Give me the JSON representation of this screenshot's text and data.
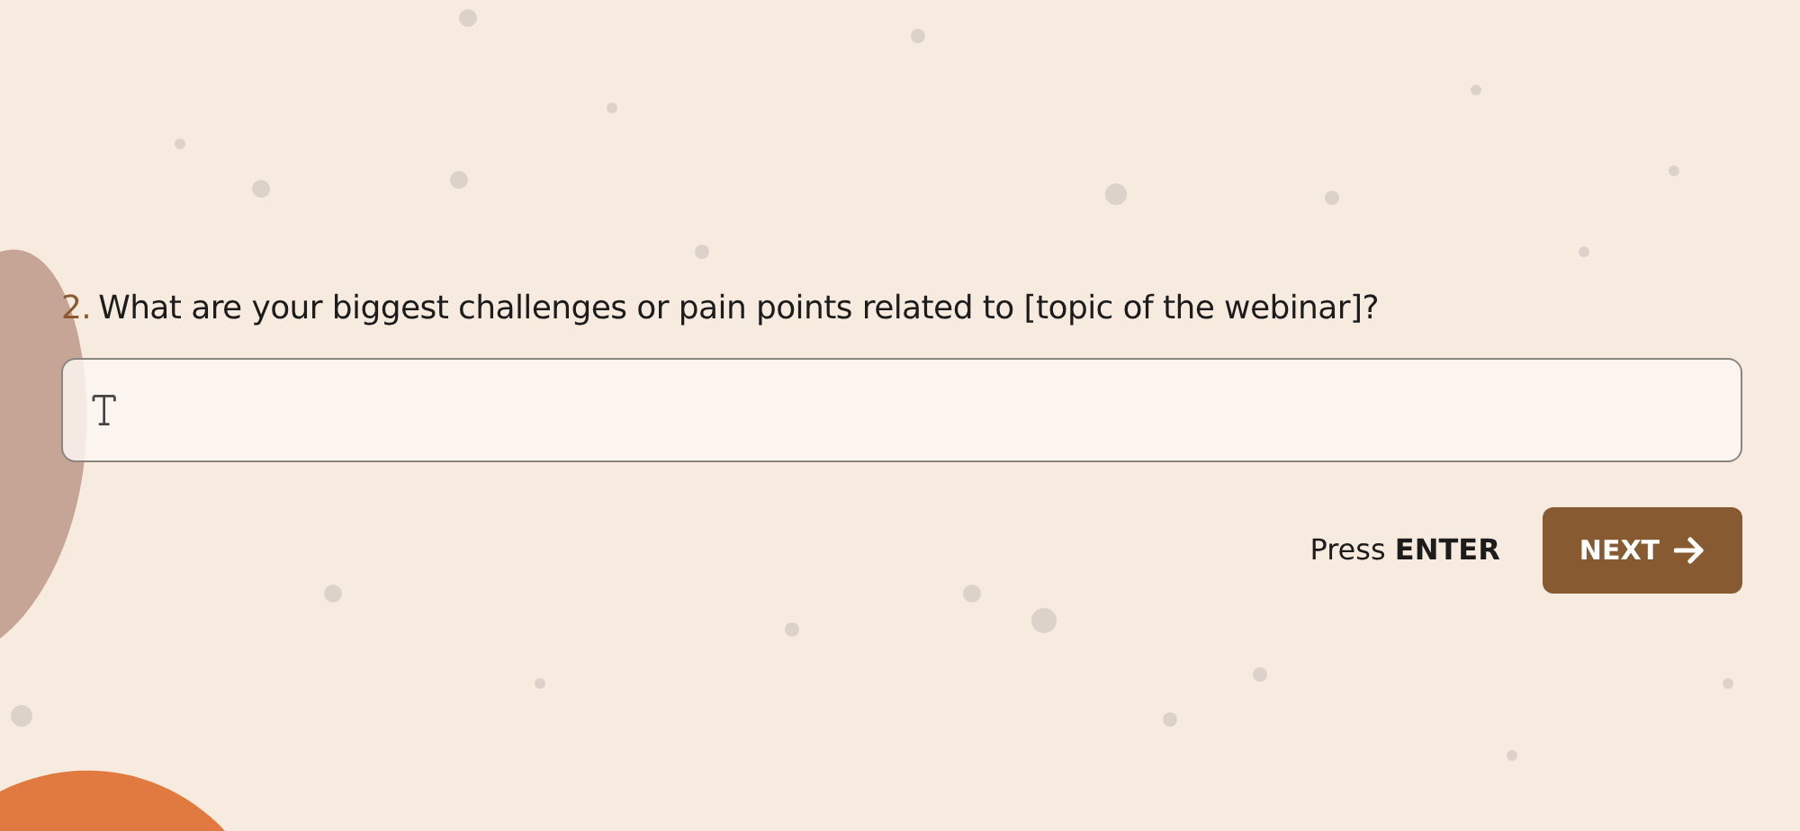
{
  "question": {
    "number": "2.",
    "text": "What are your biggest challenges or pain points related to [topic of the webinar]?"
  },
  "hint": {
    "prefix": "Press",
    "key": "ENTER"
  },
  "next_button": {
    "label": "NEXT"
  }
}
